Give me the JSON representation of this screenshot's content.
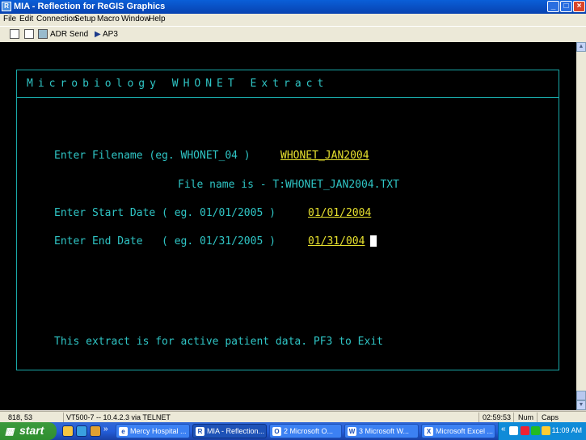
{
  "window": {
    "title": "MIA - Reflection for ReGIS Graphics",
    "app_icon": "R",
    "controls": [
      "minimize-icon",
      "maximize-icon",
      "close-icon"
    ]
  },
  "menu": [
    "File",
    "Edit",
    "Connection",
    "Setup",
    "Macro",
    "Window",
    "Help"
  ],
  "toolbar": {
    "adr_send_label": "ADR Send",
    "ap3_label": "AP3",
    "icons": [
      "connect-icon",
      "disconnect-icon",
      "send-icon",
      "play-icon"
    ]
  },
  "terminal": {
    "title": "Microbiology WHONET Extract",
    "filename_prompt": "Enter Filename (eg. WHONET_04 )",
    "filename_value": "WHONET_JAN2004",
    "file_name_info": "File name is - T:WHONET_JAN2004.TXT",
    "start_date_prompt": "Enter Start Date ( eg. 01/01/2005 )",
    "start_date_value": "01/01/2004",
    "end_date_prompt": "Enter End Date   ( eg. 01/31/2005 )",
    "end_date_value": "01/31/004",
    "footer_text": "This extract is for active patient data. PF3 to Exit",
    "colors": {
      "text": "#2fc5c5",
      "input": "#e6e02e",
      "background": "#000000"
    }
  },
  "statusbar": {
    "cursor_pos": "818, 53",
    "connection": "VT500-7 -- 10.4.2.3 via TELNET",
    "time": "02:59:53",
    "num": "Num",
    "caps": "Caps"
  },
  "taskbar": {
    "start_label": "start",
    "tasks": [
      {
        "label": "Mercy Hospital ...",
        "icon": "ie-icon"
      },
      {
        "label": "MIA - Reflection...",
        "icon": "reflection-icon",
        "active": true
      },
      {
        "label": "2 Microsoft O...",
        "icon": "outlook-icon"
      },
      {
        "label": "3 Microsoft W...",
        "icon": "word-icon"
      },
      {
        "label": "Microsoft Excel ...",
        "icon": "excel-icon"
      }
    ],
    "clock": "11:09 AM"
  }
}
